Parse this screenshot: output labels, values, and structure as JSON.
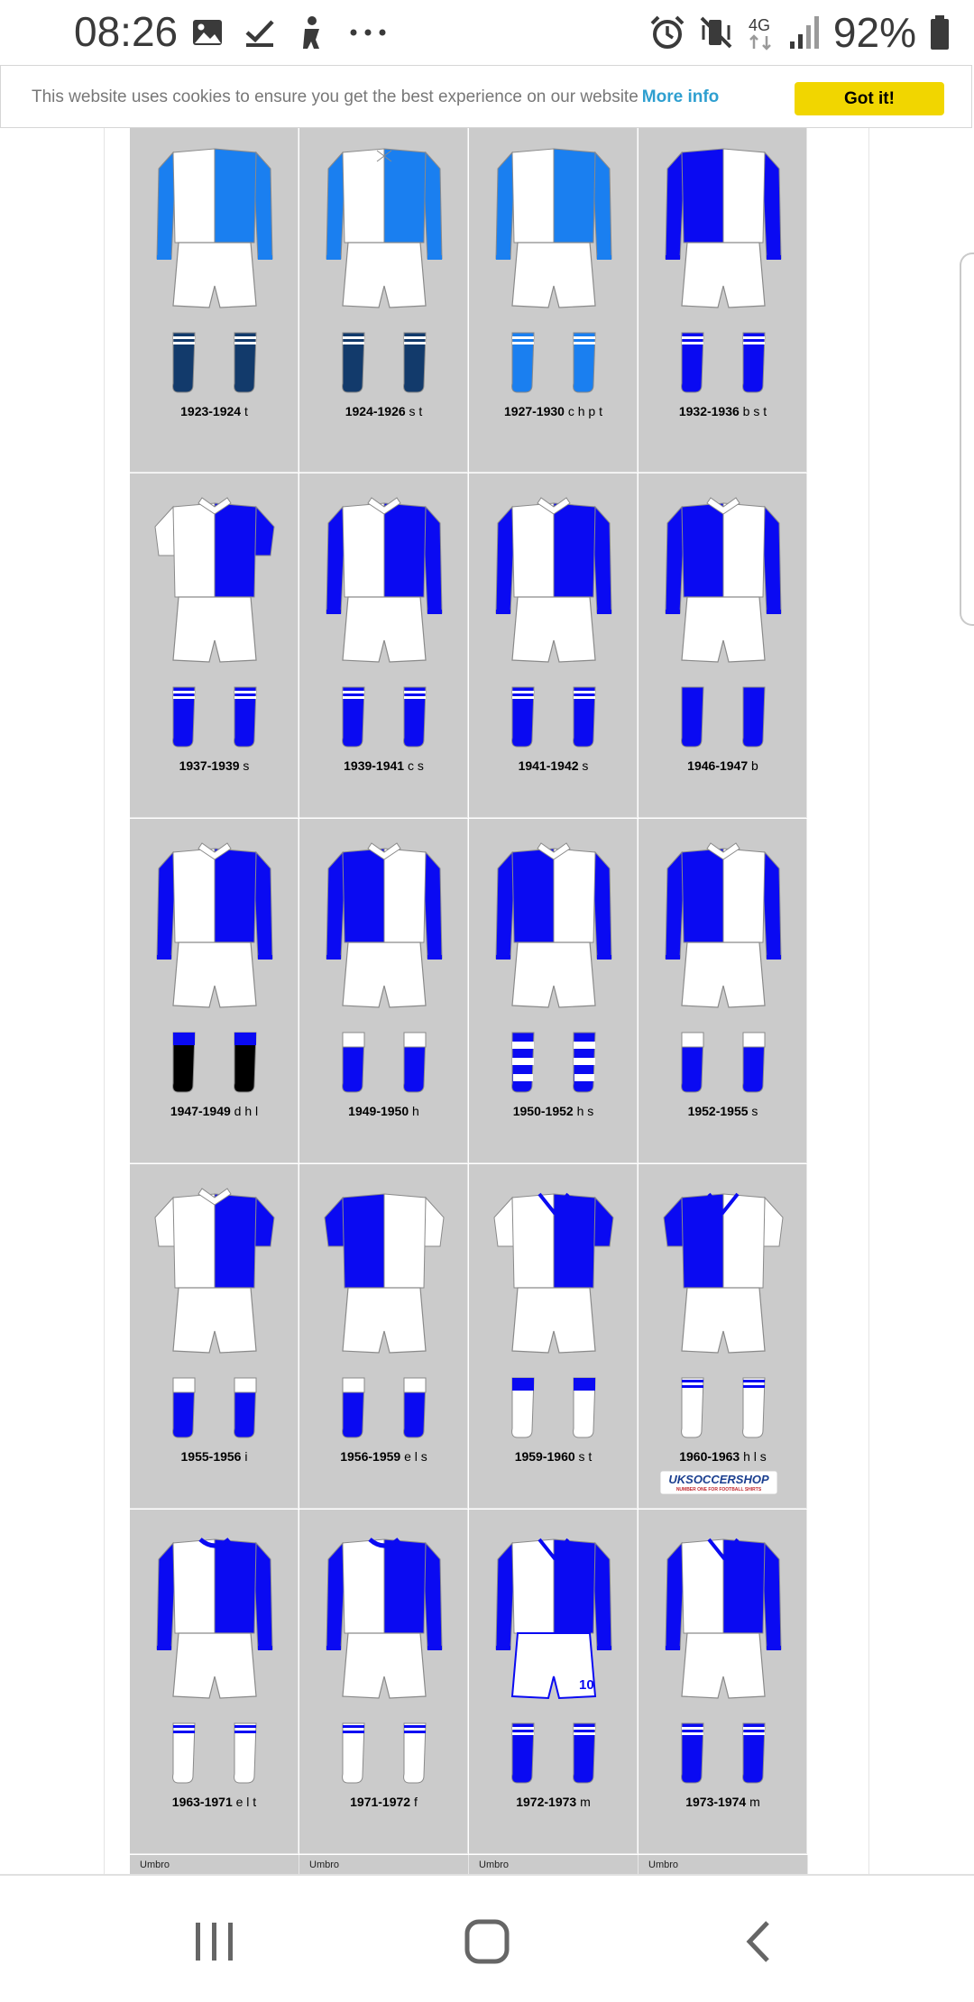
{
  "status_bar": {
    "time": "08:26",
    "left_icons": [
      "image-icon",
      "check-download-icon",
      "gesture-icon",
      "more-dots-icon"
    ],
    "right_icons": [
      "alarm-icon",
      "vibrate-mute-icon",
      "4g-icon",
      "signal-icon",
      "battery-icon"
    ],
    "network": "4G",
    "battery": "92%"
  },
  "cookie_banner": {
    "text": "This website uses cookies to ensure you get the best experience on our website",
    "link": "More info",
    "button": "Got it!"
  },
  "colors": {
    "royal_blue": "#0a0af2",
    "sky_blue": "#1a7ff0",
    "navy": "#123a6b",
    "white": "#ffffff",
    "black": "#000000",
    "cell_bg": "#cbcbcb",
    "button_yellow": "#f1d600",
    "link_blue": "#2e9fd0"
  },
  "kits": [
    {
      "years": "1923-1924",
      "notes": "t",
      "shirt": "halves",
      "shirt_color": "#1a7ff0",
      "split": "left-white",
      "collar": "none",
      "sleeves": "color",
      "sock_color": "#123a6b",
      "sock_top": "hoops-white"
    },
    {
      "years": "1924-1926",
      "notes": "s t",
      "shirt": "halves",
      "shirt_color": "#1a7ff0",
      "split": "right-color",
      "collar": "lace",
      "sleeves": "color-left",
      "sock_color": "#123a6b",
      "sock_top": "hoops-white"
    },
    {
      "years": "1927-1930",
      "notes": "c h p t",
      "shirt": "halves",
      "shirt_color": "#1a7ff0",
      "split": "left-white",
      "collar": "none",
      "sleeves": "color",
      "sock_color": "#1a7ff0",
      "sock_top": "hoops-white"
    },
    {
      "years": "1932-1936",
      "notes": "b s t",
      "shirt": "halves",
      "shirt_color": "#0a0af2",
      "split": "left-color",
      "collar": "none",
      "sleeves": "color",
      "sock_color": "#0a0af2",
      "sock_top": "hoops-white"
    },
    {
      "years": "1937-1939",
      "notes": "s",
      "shirt": "halves",
      "shirt_color": "#0a0af2",
      "split": "left-white",
      "collar": "white",
      "sleeves": "short",
      "sock_color": "#0a0af2",
      "sock_top": "hoops-white"
    },
    {
      "years": "1939-1941",
      "notes": "c s",
      "shirt": "halves",
      "shirt_color": "#0a0af2",
      "split": "left-white",
      "collar": "white",
      "sleeves": "color",
      "sock_color": "#0a0af2",
      "sock_top": "hoops-white"
    },
    {
      "years": "1941-1942",
      "notes": "s",
      "shirt": "halves",
      "shirt_color": "#0a0af2",
      "split": "left-white",
      "collar": "white",
      "sleeves": "color",
      "sock_color": "#0a0af2",
      "sock_top": "hoops-white"
    },
    {
      "years": "1946-1947",
      "notes": "b",
      "shirt": "halves",
      "shirt_color": "#0a0af2",
      "split": "left-color",
      "collar": "white",
      "sleeves": "color",
      "sock_color": "#0a0af2",
      "sock_top": "plain"
    },
    {
      "years": "1947-1949",
      "notes": "d h l",
      "shirt": "halves",
      "shirt_color": "#0a0af2",
      "split": "left-white",
      "collar": "white",
      "sleeves": "color",
      "sock_color": "#000000",
      "sock_top": "blue-top"
    },
    {
      "years": "1949-1950",
      "notes": "h",
      "shirt": "halves",
      "shirt_color": "#0a0af2",
      "split": "left-color",
      "collar": "white",
      "sleeves": "color",
      "sock_color": "#0a0af2",
      "sock_top": "white-top"
    },
    {
      "years": "1950-1952",
      "notes": "h s",
      "shirt": "halves",
      "shirt_color": "#0a0af2",
      "split": "left-color",
      "collar": "white",
      "sleeves": "color",
      "sock_color": "#0a0af2",
      "sock_top": "hooped"
    },
    {
      "years": "1952-1955",
      "notes": "s",
      "shirt": "halves",
      "shirt_color": "#0a0af2",
      "split": "left-color",
      "collar": "white",
      "sleeves": "color",
      "sock_color": "#0a0af2",
      "sock_top": "white-top"
    },
    {
      "years": "1955-1956",
      "notes": "i",
      "shirt": "halves",
      "shirt_color": "#0a0af2",
      "split": "left-white",
      "collar": "white",
      "sleeves": "short",
      "sock_color": "#0a0af2",
      "sock_top": "white-top"
    },
    {
      "years": "1956-1959",
      "notes": "e l s",
      "shirt": "halves",
      "shirt_color": "#0a0af2",
      "split": "left-color",
      "collar": "none",
      "sleeves": "short",
      "sock_color": "#0a0af2",
      "sock_top": "white-top"
    },
    {
      "years": "1959-1960",
      "notes": "s t",
      "shirt": "halves",
      "shirt_color": "#0a0af2",
      "split": "left-white",
      "collar": "v",
      "sleeves": "short",
      "sock_color": "#ffffff",
      "sock_top": "blue-top"
    },
    {
      "years": "1960-1963",
      "notes": "h l s",
      "shirt": "halves",
      "shirt_color": "#0a0af2",
      "split": "left-color",
      "collar": "v",
      "sleeves": "short",
      "sock_color": "#ffffff",
      "sock_top": "blue-hoops"
    },
    {
      "years": "1963-1971",
      "notes": "e l t",
      "shirt": "halves",
      "shirt_color": "#0a0af2",
      "split": "left-white",
      "collar": "round",
      "sleeves": "color",
      "sock_color": "#ffffff",
      "sock_top": "blue-hoops"
    },
    {
      "years": "1971-1972",
      "notes": "f",
      "shirt": "halves",
      "shirt_color": "#0a0af2",
      "split": "left-white",
      "collar": "round",
      "sleeves": "color",
      "sock_color": "#ffffff",
      "sock_top": "blue-hoops"
    },
    {
      "years": "1972-1973",
      "notes": "m",
      "shirt": "halves",
      "shirt_color": "#0a0af2",
      "split": "left-white",
      "collar": "v",
      "sleeves": "color",
      "sock_color": "#0a0af2",
      "sock_top": "hoops-white",
      "shorts_number": "10"
    },
    {
      "years": "1973-1974",
      "notes": "m",
      "shirt": "halves",
      "shirt_color": "#0a0af2",
      "split": "left-white",
      "collar": "v",
      "sleeves": "color",
      "sock_color": "#0a0af2",
      "sock_top": "hoops-white"
    }
  ],
  "sponsor_logo": "UKSOCCERSHOP",
  "sponsor_tagline": "NUMBER ONE FOR FOOTBALL SHIRTS",
  "footer": [
    "Umbro",
    "Umbro",
    "Umbro",
    "Umbro"
  ],
  "nav_bar": {
    "buttons": [
      "recent-apps-icon",
      "home-icon",
      "back-icon"
    ]
  }
}
